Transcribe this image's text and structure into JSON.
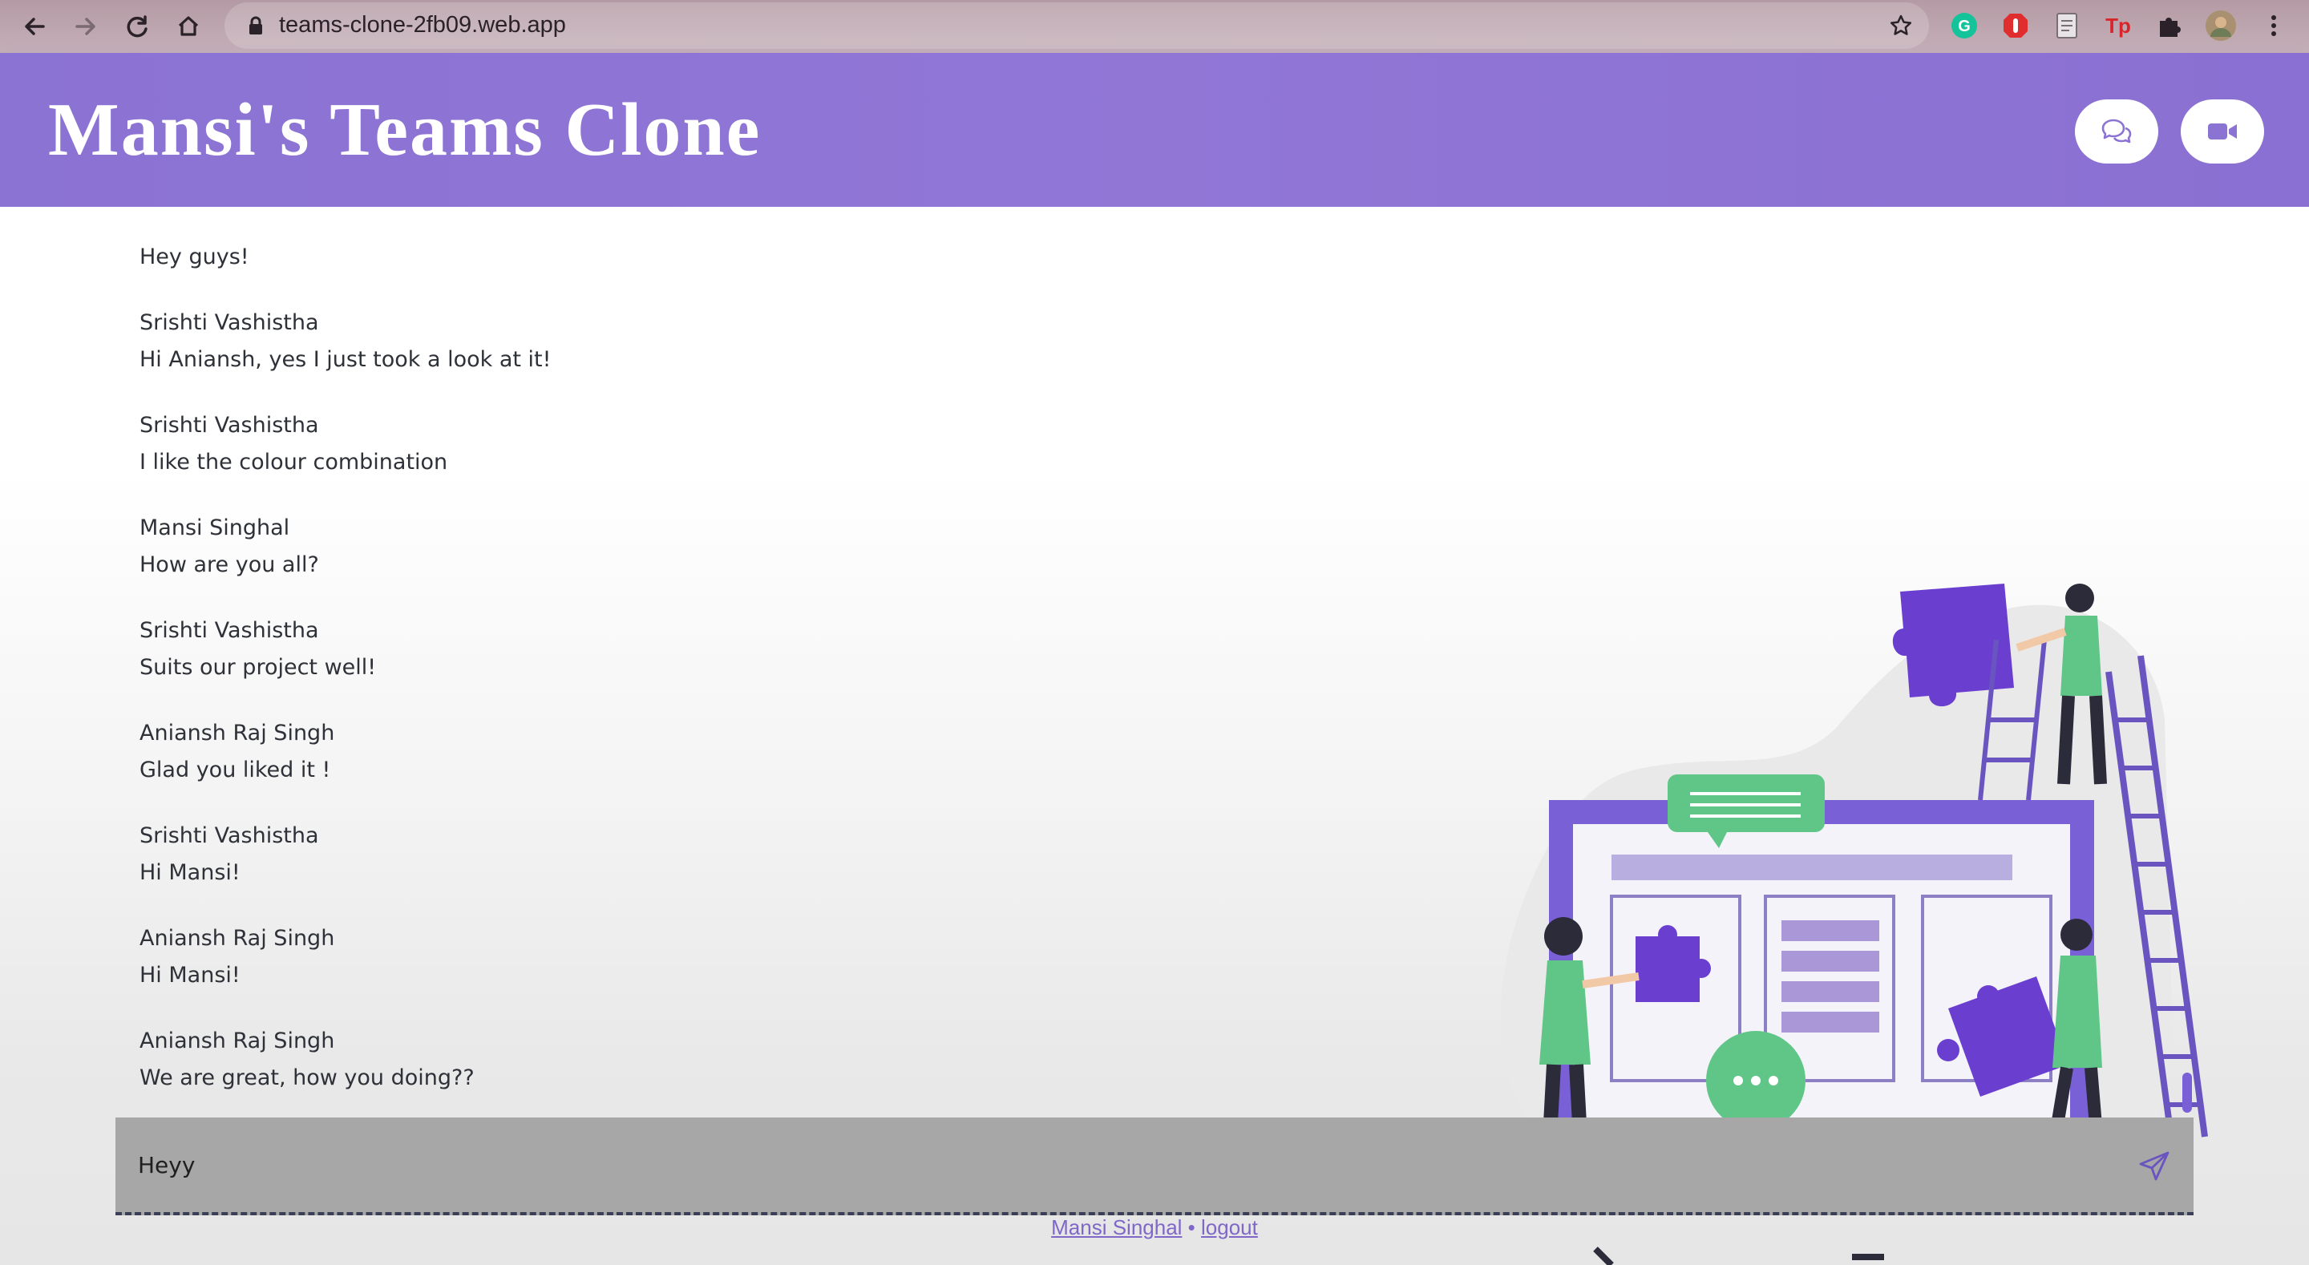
{
  "browser": {
    "url": "teams-clone-2fb09.web.app",
    "extensions": [
      "grammarly-icon",
      "adblock-icon",
      "reader-icon",
      "tp-icon",
      "puzzle-icon"
    ],
    "tp_label": "Tp"
  },
  "header": {
    "title": "Mansi's Teams Clone",
    "buttons": [
      "chat-icon",
      "video-camera-icon"
    ],
    "color": "#8b73d3"
  },
  "messages": [
    {
      "sender": "",
      "text": "Hey guys!"
    },
    {
      "sender": "Srishti Vashistha",
      "text": "Hi Aniansh, yes I just took a look at it!"
    },
    {
      "sender": "Srishti Vashistha",
      "text": "I like the colour combination"
    },
    {
      "sender": "Mansi Singhal",
      "text": "How are you all?"
    },
    {
      "sender": "Srishti Vashistha",
      "text": "Suits our project well!"
    },
    {
      "sender": "Aniansh Raj Singh",
      "text": "Glad you liked it !"
    },
    {
      "sender": "Srishti Vashistha",
      "text": "Hi Mansi!"
    },
    {
      "sender": "Aniansh Raj Singh",
      "text": "Hi Mansi!"
    },
    {
      "sender": "Aniansh Raj Singh",
      "text": "We are great, how you doing??"
    }
  ],
  "composer": {
    "value": "Heyy",
    "send_icon": "send-icon"
  },
  "footer": {
    "user": "Mansi Singhal",
    "separator": "•",
    "logout": "logout"
  }
}
